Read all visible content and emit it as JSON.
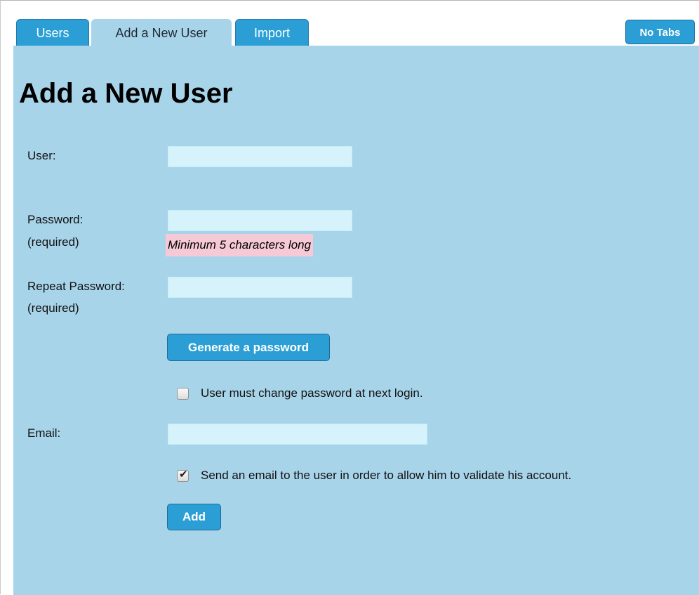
{
  "tabs": [
    {
      "label": "Users"
    },
    {
      "label": "Add a New User"
    },
    {
      "label": "Import"
    }
  ],
  "no_tabs_label": "No Tabs",
  "title": "Add a New User",
  "form": {
    "user": {
      "label": "User:",
      "value": ""
    },
    "password": {
      "label": "Password:",
      "required": "(required)",
      "value": "",
      "hint": "Minimum 5 characters long"
    },
    "repeat_password": {
      "label": "Repeat Password:",
      "required": "(required)",
      "value": ""
    },
    "generate_label": "Generate a password",
    "must_change": {
      "label": "User must change password at next login.",
      "checked": false
    },
    "email": {
      "label": "Email:",
      "value": ""
    },
    "send_email": {
      "label": "Send an email to the user in order to allow him to validate his account.",
      "checked": true
    },
    "add_label": "Add"
  },
  "icons": {
    "checkmark": "✔"
  },
  "colors": {
    "panel": "#a8d4ea",
    "tab": "#2b9fd5",
    "input": "#d6f3fb",
    "hint": "#f6c9d6"
  }
}
